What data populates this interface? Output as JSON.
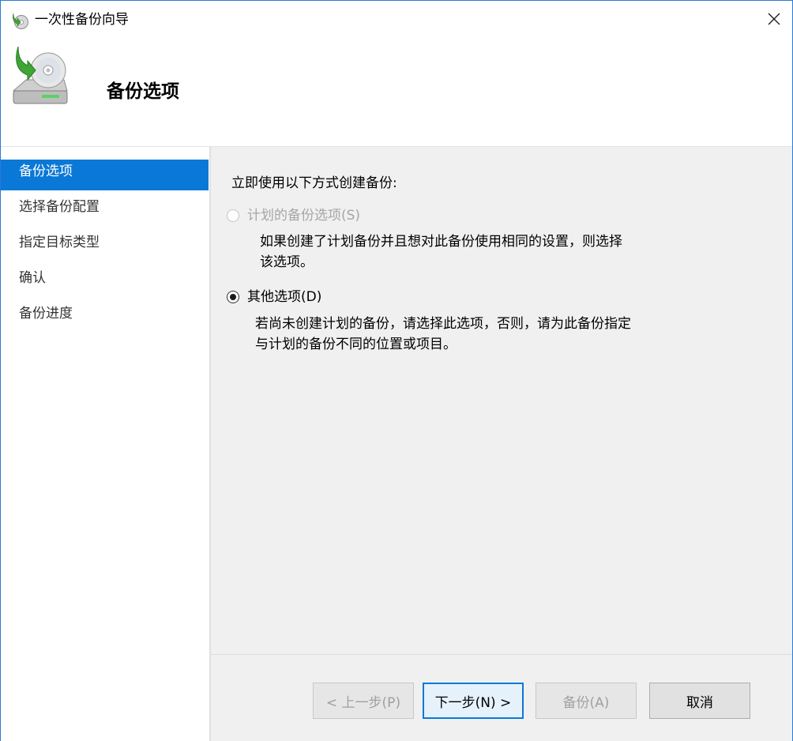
{
  "window": {
    "title": "一次性备份向导"
  },
  "header": {
    "title": "备份选项"
  },
  "sidebar": {
    "items": [
      {
        "label": "备份选项"
      },
      {
        "label": "选择备份配置"
      },
      {
        "label": "指定目标类型"
      },
      {
        "label": "确认"
      },
      {
        "label": "备份进度"
      }
    ],
    "selected_index": 0
  },
  "main": {
    "prompt": "立即使用以下方式创建备份:",
    "options": [
      {
        "label": "计划的备份选项(S)",
        "desc_line1": "如果创建了计划备份并且想对此备份使用相同的设置，则选择",
        "desc_line2": "该选项。",
        "enabled": false,
        "selected": false
      },
      {
        "label": "其他选项(D)",
        "desc_line1": "若尚未创建计划的备份，请选择此选项，否则，请为此备份指定",
        "desc_line2": "与计划的备份不同的位置或项目。",
        "enabled": true,
        "selected": true
      }
    ]
  },
  "footer": {
    "back_label": "< 上一步(P)",
    "next_label": "下一步(N) >",
    "backup_label": "备份(A)",
    "cancel_label": "取消"
  },
  "colors": {
    "accent": "#0a78d7",
    "panel_bg": "#f0f0f0",
    "disabled_text": "#a6a6a6"
  },
  "icons": {
    "title": "backup-wizard-icon",
    "header": "backup-disc-drive-icon",
    "close": "close-icon"
  }
}
